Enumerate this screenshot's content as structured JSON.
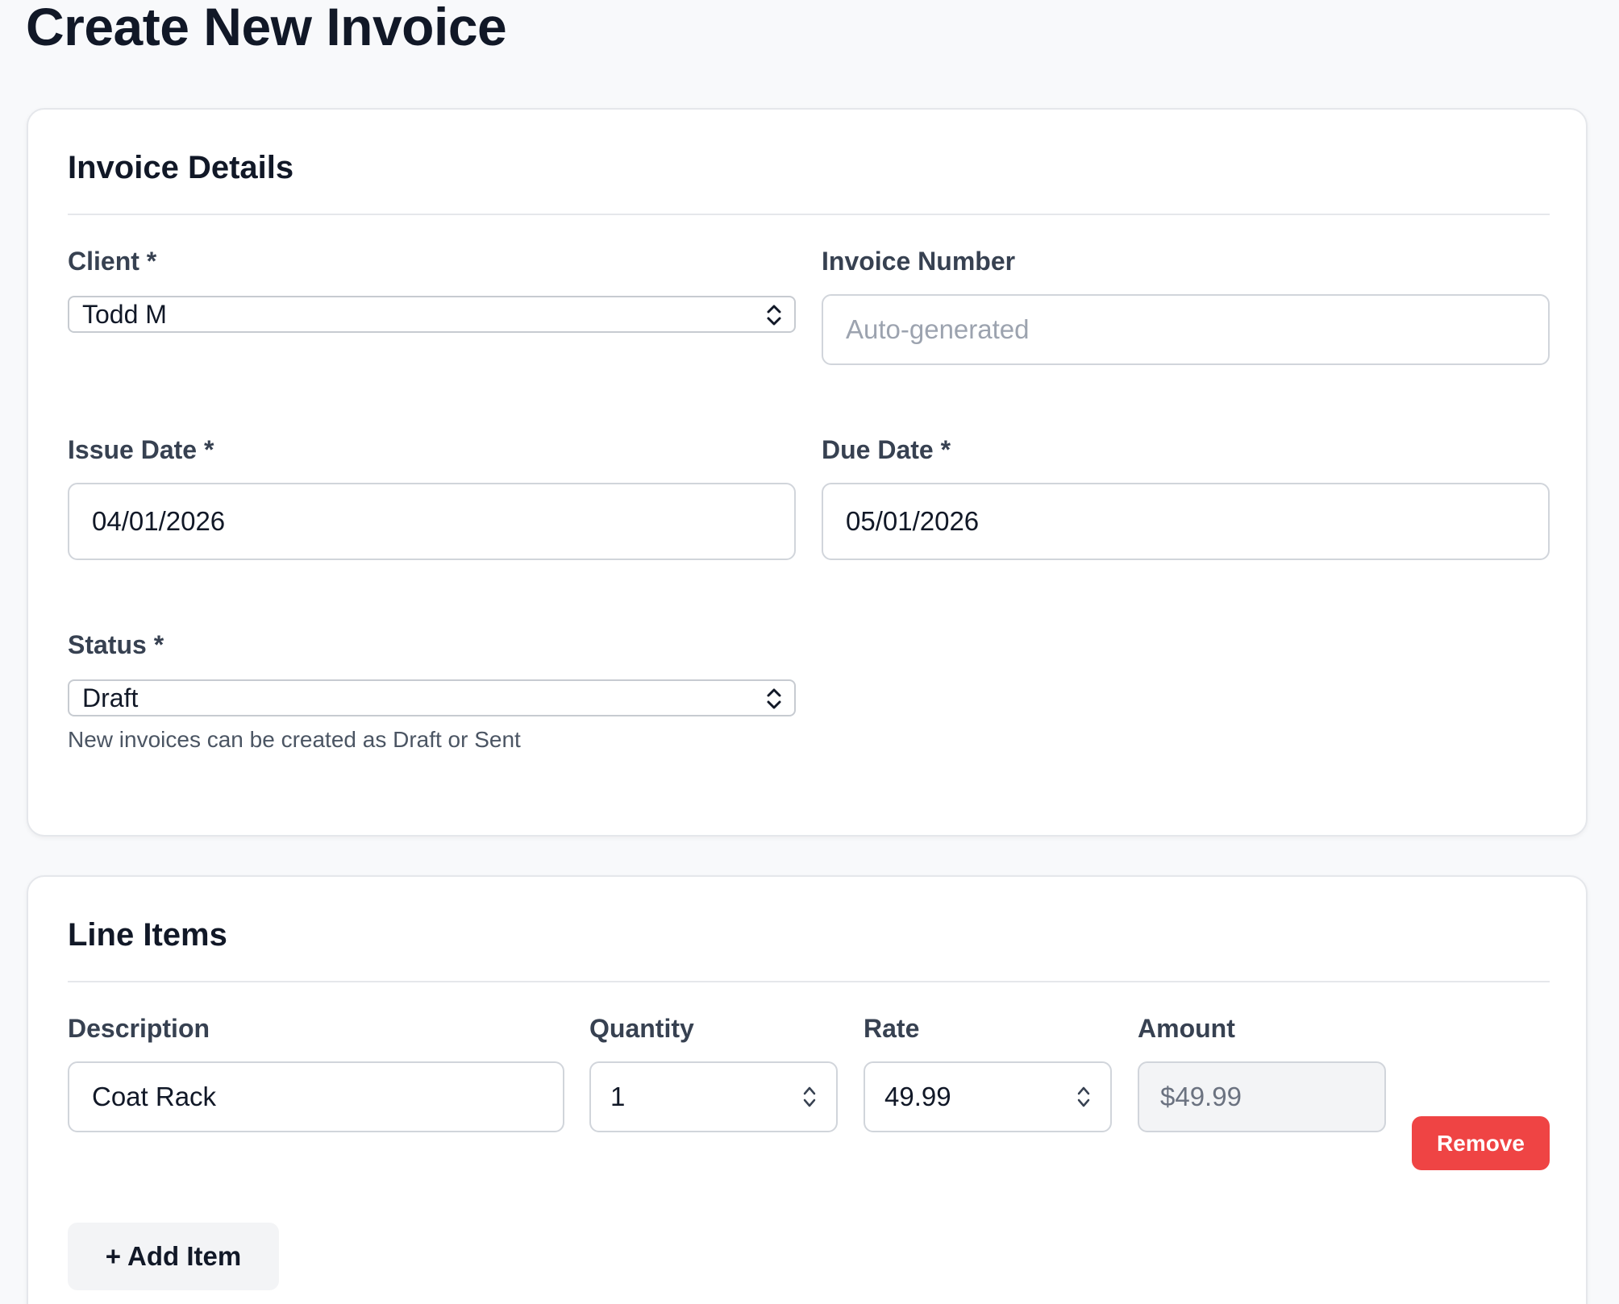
{
  "page": {
    "title": "Create New Invoice"
  },
  "details": {
    "heading": "Invoice Details",
    "client": {
      "label": "Client *",
      "value": "Todd M"
    },
    "invoice_number": {
      "label": "Invoice Number",
      "placeholder": "Auto-generated"
    },
    "issue_date": {
      "label": "Issue Date *",
      "value": "04/01/2026"
    },
    "due_date": {
      "label": "Due Date *",
      "value": "05/01/2026"
    },
    "status": {
      "label": "Status *",
      "value": "Draft",
      "help": "New invoices can be created as Draft or Sent"
    }
  },
  "line_items": {
    "heading": "Line Items",
    "columns": {
      "description": "Description",
      "quantity": "Quantity",
      "rate": "Rate",
      "amount": "Amount"
    },
    "rows": [
      {
        "description": "Coat Rack",
        "quantity": "1",
        "rate": "49.99",
        "amount": "$49.99",
        "remove_label": "Remove"
      }
    ],
    "add_label": "+ Add Item"
  },
  "colors": {
    "accent_danger": "#ef4444",
    "text_primary": "#111827",
    "text_label": "#374151",
    "border": "#d1d5db",
    "page_bg": "#f8f9fb"
  }
}
